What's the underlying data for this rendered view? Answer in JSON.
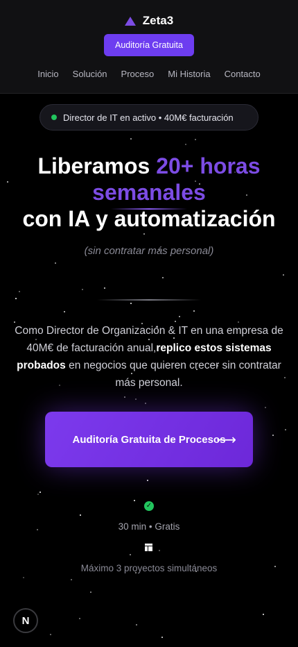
{
  "header": {
    "brand": "Zeta3",
    "cta": "Auditoría Gratuita",
    "nav": [
      "Inicio",
      "Solución",
      "Proceso",
      "Mi Historia",
      "Contacto"
    ]
  },
  "hero": {
    "badge": "Director de IT en activo • 40M€ facturación",
    "title_1": "Liberamos ",
    "title_highlight_1": "20+ horas",
    "title_highlight_2": "semanales",
    "title_2": "con IA y automatización",
    "subtitle": "(sin contratar más personal)",
    "description_1": "Como Director de Organización & IT en una empresa de 40M€ de facturación anual,",
    "description_bold": "replico estos sistemas probados",
    "description_2": " en negocios que quieren crecer sin contratar más personal.",
    "cta_label": "Auditoría Gratuita de Procesos",
    "cta_icon": "arrow-right-icon",
    "meta_1_icon": "check-circle-icon",
    "meta_1": "30 min • Gratis",
    "meta_2_icon": "layout-icon",
    "meta_2": "Máximo 3 proyectos simultáneos"
  },
  "badge_overlay": "N",
  "colors": {
    "accent": "#7c4ce4",
    "button": "#6d3df0",
    "status": "#22c55e",
    "background": "#000000"
  }
}
